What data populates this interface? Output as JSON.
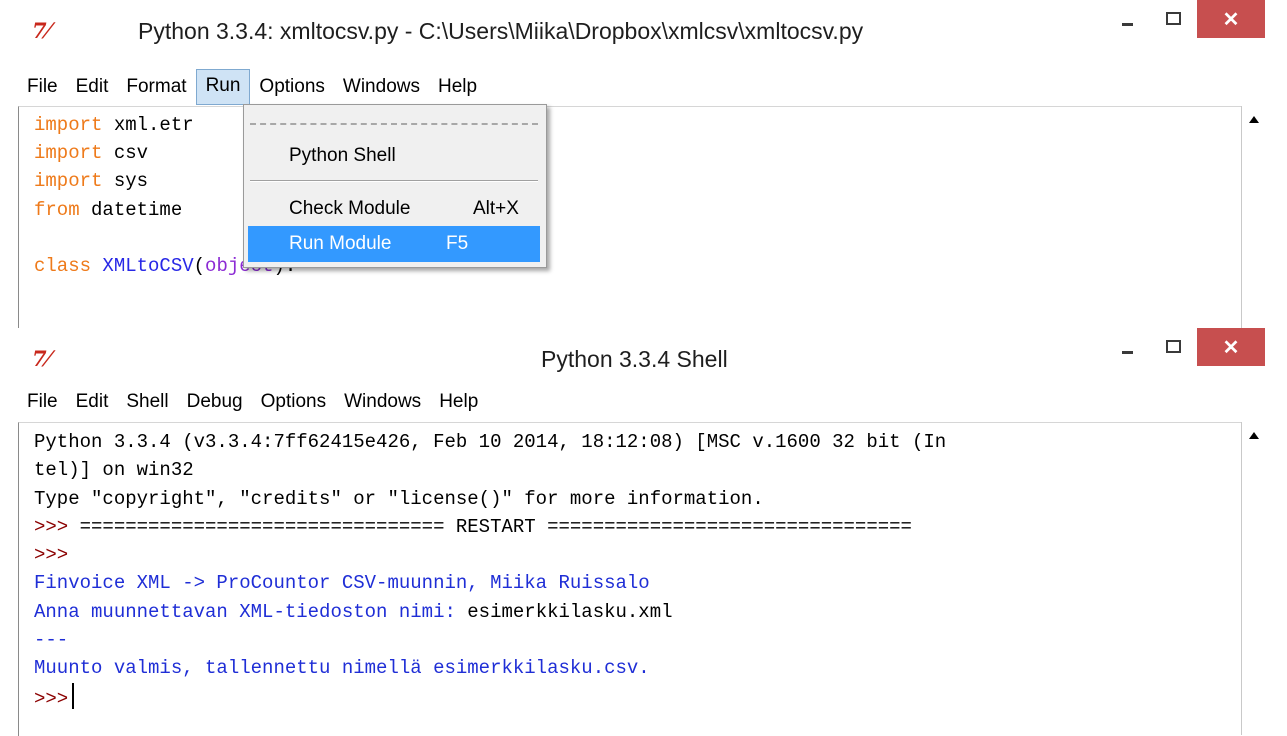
{
  "editor_window": {
    "app_icon": "7⁄",
    "title": "Python 3.3.4: xmltocsv.py - C:\\Users\\Miika\\Dropbox\\xmlcsv\\xmltocsv.py",
    "menu": [
      "File",
      "Edit",
      "Format",
      "Run",
      "Options",
      "Windows",
      "Help"
    ],
    "active_menu": "Run",
    "code": {
      "line1": {
        "kw": "import",
        "rest": " xml.etr"
      },
      "line2": {
        "kw": "import",
        "rest": " csv"
      },
      "line3": {
        "kw": "import",
        "rest": " sys"
      },
      "line4": {
        "kw": "from",
        "rest": " datetime"
      },
      "line6": {
        "kw": "class",
        "name": "XMLtoCSV",
        "open": "(",
        "base": "object",
        "close": "):"
      }
    }
  },
  "run_menu": {
    "items": [
      {
        "label": "Python Shell",
        "accel": ""
      },
      {
        "label": "Check Module",
        "accel": "Alt+X"
      },
      {
        "label": "Run Module",
        "accel": "F5",
        "highlighted": true
      }
    ]
  },
  "shell_window": {
    "app_icon": "7⁄",
    "title": "Python 3.3.4 Shell",
    "menu": [
      "File",
      "Edit",
      "Shell",
      "Debug",
      "Options",
      "Windows",
      "Help"
    ],
    "lines": {
      "l1": "Python 3.3.4 (v3.3.4:7ff62415e426, Feb 10 2014, 18:12:08) [MSC v.1600 32 bit (In",
      "l2": "tel)] on win32",
      "l3": "Type \"copyright\", \"credits\" or \"license()\" for more information.",
      "l4_prompt": ">>> ",
      "l4_rest": "================================ RESTART ================================",
      "l5_prompt": ">>>",
      "l6": "Finvoice XML -> ProCountor CSV-muunnin, Miika Ruissalo",
      "l7_out": "Anna muunnettavan XML-tiedoston nimi: ",
      "l7_input": "esimerkkilasku.xml",
      "l8": "---",
      "l9": "Muunto valmis, tallennettu nimellä esimerkkilasku.csv.",
      "l10_prompt": ">>>"
    }
  },
  "colors": {
    "keyword": "#ee7a1a",
    "definition": "#2828e6",
    "builtin": "#8c2bd4",
    "stdout": "#1f2ed6",
    "prompt": "#8b0000",
    "close_button": "#c74f4f",
    "menu_highlight": "#3399ff"
  }
}
